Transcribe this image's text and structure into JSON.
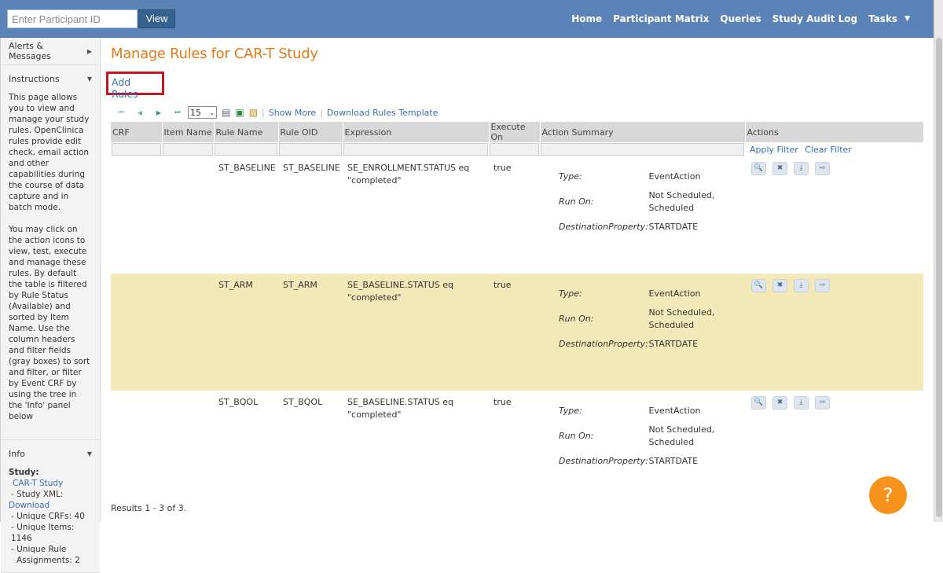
{
  "topbar": {
    "participant_placeholder": "Enter Participant ID",
    "view_label": "View",
    "nav": [
      "Home",
      "Participant Matrix",
      "Queries",
      "Study Audit Log",
      "Tasks"
    ]
  },
  "sidebar": {
    "alerts_label": "Alerts & Messages",
    "instructions_label": "Instructions",
    "instructions_p1": "This page allows you to view and manage your study rules. OpenClinica rules provide edit check, email action and other capabilities during the course of data capture and in batch mode.",
    "instructions_p2": "You may click on the action icons to view, test, execute and manage these rules. By default the table is filtered by Rule Status (Available) and sorted by Item Name. Use the column headers and filter fields (gray boxes) to sort and filter, or filter by Event CRF by using the tree in the 'Info' panel below",
    "info_label": "Info",
    "study_label": "Study:",
    "study_name": "CAR-T Study",
    "study_xml_label": "- Study XML:",
    "download_label": "Download",
    "unique_crfs": "- Unique CRFs:  40",
    "unique_items": "- Unique Items:  1146",
    "unique_rule_1": "- Unique Rule",
    "unique_rule_2": "Assignments:  2"
  },
  "main": {
    "title": "Manage  Rules for CAR-T Study",
    "add_rules": "Add Rules",
    "page_size": "15",
    "show_more": "Show More",
    "download_template": "Download Rules Template",
    "apply_filter": "Apply Filter",
    "clear_filter": "Clear Filter",
    "results": "Results 1 - 3 of 3."
  },
  "table": {
    "headers": [
      "CRF",
      "Item Name",
      "Rule Name",
      "Rule OID",
      "Expression",
      "Execute On",
      "Action Summary",
      "Actions"
    ],
    "summary_keys": [
      "Type:",
      "Run On:",
      "DestinationProperty:"
    ],
    "rows": [
      {
        "crf": "",
        "item": "",
        "rule_name": "ST_BASELINE",
        "rule_oid": "ST_BASELINE",
        "expression": "SE_ENROLLMENT.STATUS eq \"completed\"",
        "execute_on": "true",
        "type": "EventAction",
        "run_on": "Not Scheduled, Scheduled",
        "dest": "STARTDATE"
      },
      {
        "crf": "",
        "item": "",
        "rule_name": "ST_ARM",
        "rule_oid": "ST_ARM",
        "expression": "SE_BASELINE.STATUS eq \"completed\"",
        "execute_on": "true",
        "type": "EventAction",
        "run_on": "Not Scheduled, Scheduled",
        "dest": "STARTDATE"
      },
      {
        "crf": "",
        "item": "",
        "rule_name": "ST_BQOL",
        "rule_oid": "ST_BQOL",
        "expression": "SE_BASELINE.STATUS eq \"completed\"",
        "execute_on": "true",
        "type": "EventAction",
        "run_on": "Not Scheduled, Scheduled",
        "dest": "STARTDATE"
      }
    ]
  },
  "help_label": "?"
}
